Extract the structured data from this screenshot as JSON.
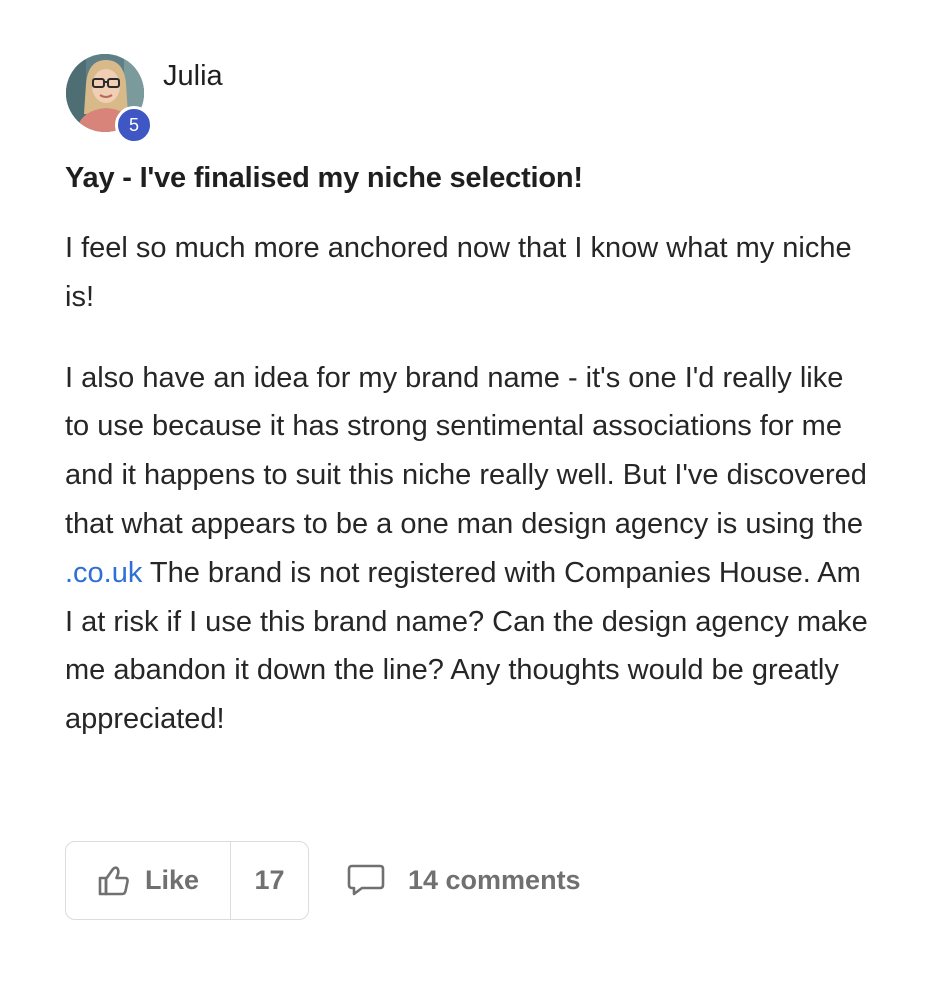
{
  "author": {
    "name": "Julia",
    "level": "5",
    "avatar_icon": "user-photo"
  },
  "post": {
    "title": "Yay - I've finalised my niche selection!",
    "paragraph1": "I feel so much more anchored now that I know what my niche is!",
    "paragraph2_before_link": "I also have an idea for my brand name - it's one I'd really like to use because it has strong sentimental associations for me and it happens to suit this niche really well. But I've discovered that what appears to be a one man design agency is using the ",
    "paragraph2_link": ".co.uk",
    "paragraph2_after_link": " The brand is not registered with Companies House. Am I at risk if I use this brand name? Can the design agency make me abandon it down the line? Any thoughts would be greatly appreciated!"
  },
  "actions": {
    "like_label": "Like",
    "like_count": "17",
    "comments_label": "14 comments",
    "like_icon": "thumbs-up-icon",
    "comment_icon": "speech-bubble-icon"
  },
  "colors": {
    "badge": "#3f57c4",
    "link": "#2f6fd6",
    "muted_text": "#707070",
    "border": "#dcdcdc"
  }
}
